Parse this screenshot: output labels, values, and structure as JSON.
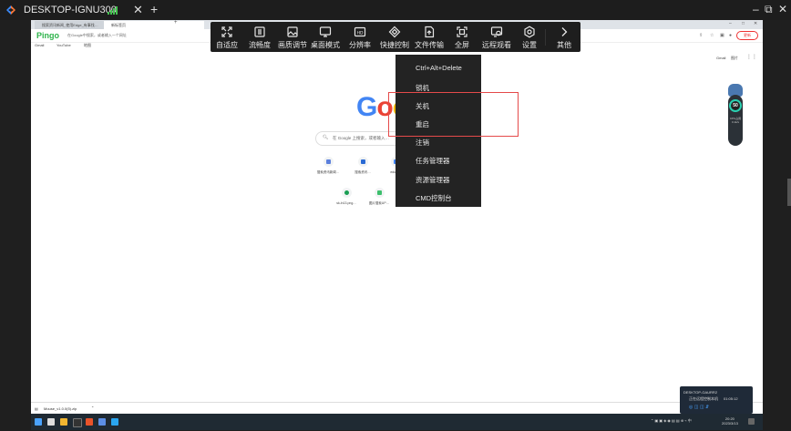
{
  "remote_window": {
    "title": "DESKTOP-IGNU300",
    "tab_close": "✕",
    "new_tab": "+",
    "controls": {
      "minimize": "–",
      "restore": "⧉",
      "close": "✕"
    }
  },
  "browser": {
    "tabs": [
      {
        "label": "搜索资讯新闻_使用Edge_有事找…"
      },
      {
        "label": "新标签页"
      }
    ],
    "brand": "Pingo",
    "address_placeholder": "在Google中搜索，或者输入一个网址",
    "profile_button": "更新",
    "bookmarks": [
      "Gmail",
      "YouTube",
      "地图"
    ],
    "top_links": [
      "Gmail",
      "图片"
    ],
    "logo_letters": [
      {
        "ch": "G",
        "color": "#4285f4"
      },
      {
        "ch": "o",
        "color": "#ea4335"
      },
      {
        "ch": "o",
        "color": "#fbbc05"
      }
    ],
    "search_placeholder": "在 Google 上搜索，或者输入…",
    "shortcuts": [
      {
        "label": "搜索资讯新闻…",
        "color": "#5b7fdc"
      },
      {
        "label": "搜索资讯…",
        "color": "#2a6ad4"
      },
      {
        "label": "edu.t…",
        "color": "#4285f4"
      },
      {
        "label": "sk-ln13.png…",
        "color": "#1a9e53"
      },
      {
        "label": "图片搜索UP…",
        "color": "#3cbf6c"
      }
    ],
    "download_file": "Mouse_v1.0.0(5).zip"
  },
  "windows": {
    "clock_time": "20:20",
    "clock_date": "2023/3/13",
    "notification_title": "DESKTOP-GAURR2",
    "notification_text": "正在远程控制本机",
    "notification_time": "01:05:12"
  },
  "widget": {
    "percent": "50",
    "sub1": "CPU占用",
    "sub2": "0.1k/s"
  },
  "toolbar": {
    "items": [
      {
        "label": "自适应",
        "icon": "fit-screen-icon"
      },
      {
        "label": "流畅度",
        "icon": "fluency-icon"
      },
      {
        "label": "画质调节",
        "icon": "image-quality-icon"
      },
      {
        "label": "桌面模式",
        "icon": "desktop-mode-icon"
      },
      {
        "label": "分辨率",
        "icon": "resolution-icon"
      },
      {
        "label": "快捷控制",
        "icon": "quick-control-icon"
      },
      {
        "label": "文件传输",
        "icon": "file-transfer-icon"
      },
      {
        "label": "全屏",
        "icon": "fullscreen-icon"
      },
      {
        "label": "远程观看",
        "icon": "remote-view-icon"
      },
      {
        "label": "设置",
        "icon": "settings-icon"
      },
      {
        "label": "其他",
        "icon": "more-icon"
      }
    ]
  },
  "quick_menu": {
    "items": [
      {
        "label": "Ctrl+Alt+Delete"
      },
      {
        "label": "锁机"
      },
      {
        "label": "关机"
      },
      {
        "label": "重启"
      },
      {
        "label": "注销"
      },
      {
        "label": "任务管理器"
      },
      {
        "label": "资源管理器"
      },
      {
        "label": "CMD控制台"
      }
    ]
  },
  "colors": {
    "highlight": "#e54a4a",
    "toolbar_bg": "#1e1e1e",
    "accent_green": "#43c24f"
  }
}
